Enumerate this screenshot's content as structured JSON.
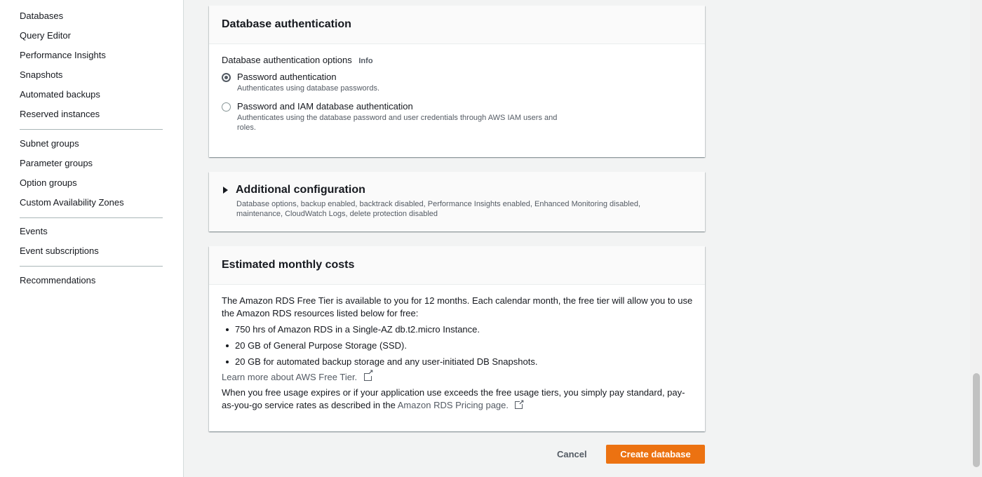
{
  "sidebar": {
    "group1": [
      "Databases",
      "Query Editor",
      "Performance Insights",
      "Snapshots",
      "Automated backups",
      "Reserved instances"
    ],
    "group2": [
      "Subnet groups",
      "Parameter groups",
      "Option groups",
      "Custom Availability Zones"
    ],
    "group3": [
      "Events",
      "Event subscriptions"
    ],
    "group4": [
      "Recommendations"
    ]
  },
  "auth_panel": {
    "title": "Database authentication",
    "options_label": "Database authentication options",
    "info": "Info",
    "options": [
      {
        "label": "Password authentication",
        "desc": "Authenticates using database passwords.",
        "selected": true
      },
      {
        "label": "Password and IAM database authentication",
        "desc": "Authenticates using the database password and user credentials through AWS IAM users and roles.",
        "selected": false
      }
    ]
  },
  "additional_config": {
    "title": "Additional configuration",
    "desc": "Database options, backup enabled, backtrack disabled, Performance Insights enabled, Enhanced Monitoring disabled, maintenance, CloudWatch Logs, delete protection disabled"
  },
  "costs_panel": {
    "title": "Estimated monthly costs",
    "intro": "The Amazon RDS Free Tier is available to you for 12 months. Each calendar month, the free tier will allow you to use the Amazon RDS resources listed below for free:",
    "items": [
      "750 hrs of Amazon RDS in a Single-AZ db.t2.micro Instance.",
      "20 GB of General Purpose Storage (SSD).",
      "20 GB for automated backup storage and any user-initiated DB Snapshots."
    ],
    "learn_more": "Learn more about AWS Free Tier.",
    "footer_text": "When you free usage expires or if your application use exceeds the free usage tiers, you simply pay standard, pay-as-you-go service rates as described in the",
    "pricing_link": "Amazon RDS Pricing page."
  },
  "actions": {
    "cancel": "Cancel",
    "create": "Create database"
  },
  "colors": {
    "primary_button": "#ec7211",
    "link": "#545b64"
  }
}
